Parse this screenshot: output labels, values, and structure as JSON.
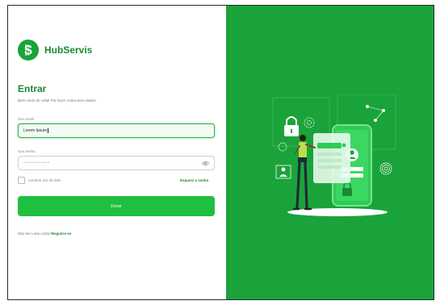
{
  "brand": {
    "name": "HubServis",
    "logo_icon": "dollar-sign-icon",
    "color": "#1aa33b"
  },
  "login": {
    "title": "Entrar",
    "subtitle": "Bem vindo de volta! Por favor, insira seus dados.",
    "email_label": "Seu email",
    "email_value": "Lorem Ipsum",
    "password_label": "Sua senha",
    "password_value": "••••••••••••",
    "remember_label": "Lembrar por 30 dias",
    "forgot_label": "Esqueci a senha",
    "submit_label": "Entrar",
    "signup_prompt": "Não tem uma conta?",
    "signup_link": "Registre-se"
  },
  "colors": {
    "accent": "#1aa33b",
    "button": "#1fbf3f",
    "panel": "#1aa33b"
  },
  "illustration": {
    "icon": "mobile-security-illustration"
  }
}
